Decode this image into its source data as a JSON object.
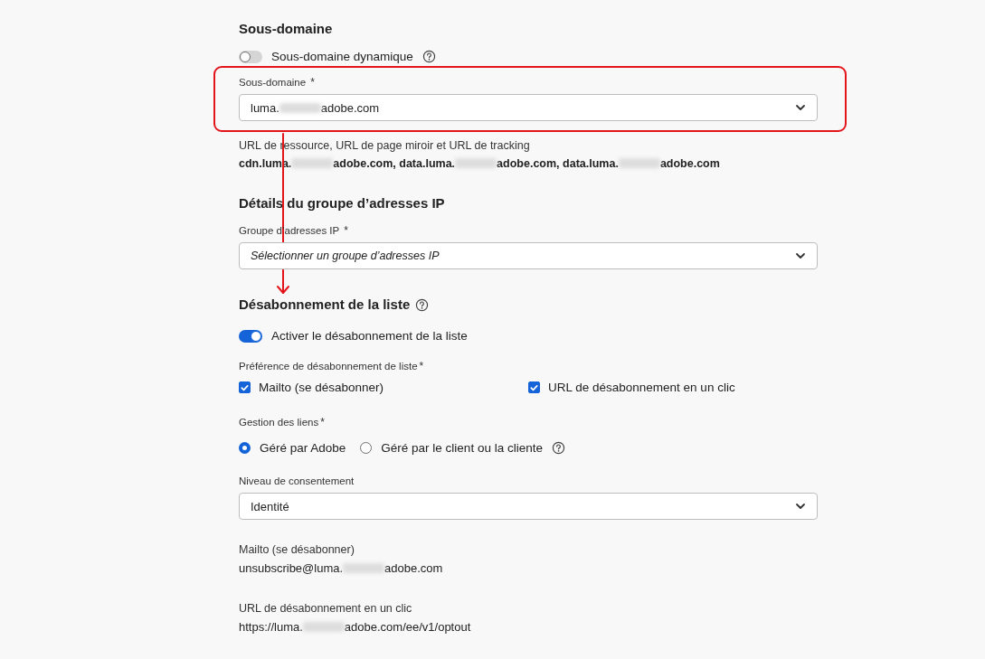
{
  "subdomain_section": {
    "title": "Sous-domaine",
    "dynamic_toggle": {
      "label": "Sous-domaine dynamique",
      "on": false,
      "help": true
    },
    "field": {
      "label": "Sous-domaine",
      "required_mark": "*",
      "value_parts": [
        "luma.",
        "adobe.com"
      ]
    },
    "urls": {
      "label": "URL de ressource, URL de page miroir et URL de tracking",
      "value_parts": [
        "cdn.luma.",
        "adobe.com, data.luma.",
        "adobe.com, data.luma.",
        "adobe.com"
      ]
    }
  },
  "ip_section": {
    "title": "Détails du groupe d’adresses IP",
    "field": {
      "label": "Groupe d’adresses IP",
      "required_mark": "*",
      "placeholder": "Sélectionner un groupe d’adresses IP"
    }
  },
  "unsubscribe_section": {
    "title": "Désabonnement de la liste",
    "help": true,
    "toggle": {
      "label": "Activer le désabonnement de la liste",
      "on": true
    },
    "preference": {
      "label": "Préférence de désabonnement de liste",
      "required_mark": "*",
      "options": [
        {
          "label": "Mailto (se désabonner)",
          "checked": true
        },
        {
          "label": "URL de désabonnement en un clic",
          "checked": true
        }
      ]
    },
    "link_management": {
      "label": "Gestion des liens",
      "required_mark": "*",
      "options": [
        {
          "label": "Géré par Adobe",
          "selected": true,
          "help": false
        },
        {
          "label": "Géré par le client ou la cliente",
          "selected": false,
          "help": true
        }
      ]
    },
    "consent": {
      "label": "Niveau de consentement",
      "value": "Identité"
    },
    "mailto": {
      "label": "Mailto (se désabonner)",
      "value_parts": [
        "unsubscribe@luma.",
        "adobe.com"
      ]
    },
    "one_click": {
      "label": "URL de désabonnement en un clic",
      "value_parts": [
        "https://luma.",
        "adobe.com/ee/v1/optout"
      ]
    }
  }
}
